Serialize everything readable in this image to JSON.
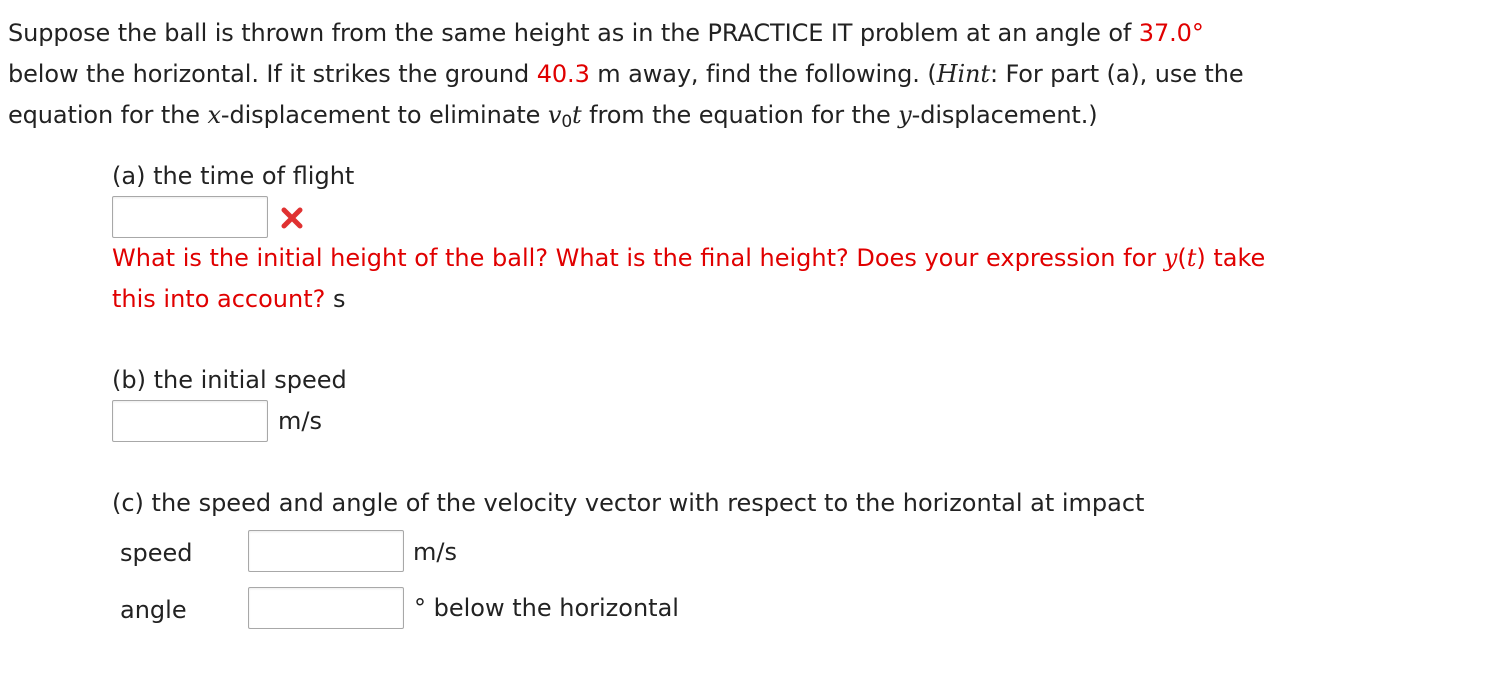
{
  "problem": {
    "text_1": "Suppose the ball is thrown from the same height as in the PRACTICE IT problem at an angle of ",
    "angle_value": "37.0°",
    "text_2": "below the horizontal. If it strikes the ground ",
    "distance_value": "40.3",
    "text_3": " m away, find the following. (",
    "hint_word": "Hint",
    "text_4": ": For part (a), use the",
    "text_5": "equation for the ",
    "x_var": "x",
    "text_6": "-displacement to eliminate ",
    "v_var": "v",
    "v_sub": "0",
    "t_var": "t",
    "text_7": " from the equation for the ",
    "y_var": "y",
    "text_8": "-displacement.)"
  },
  "part_a": {
    "label": "(a) the time of flight",
    "answer_value": "",
    "feedback_icon": "incorrect-x-icon",
    "hint_1": "What is the initial height of the ball? What is the final height? Does your expression for ",
    "hint_y": "y",
    "hint_paren_open": "(",
    "hint_t": "t",
    "hint_paren_close": ")",
    "hint_2": " take",
    "hint_3": "this into account?",
    "unit": "s"
  },
  "part_b": {
    "label": "(b) the initial speed",
    "answer_value": "",
    "unit": "m/s"
  },
  "part_c": {
    "label": "(c) the speed and angle of the velocity vector with respect to the horizontal at impact",
    "speed_label": "speed",
    "speed_value": "",
    "speed_unit": "m/s",
    "angle_label": "angle",
    "angle_value": "",
    "angle_unit": "° below the horizontal"
  },
  "colors": {
    "text": "#222222",
    "highlight_red": "#e00000",
    "input_border": "#a8a8a8",
    "wrong_icon": "#e03131"
  }
}
